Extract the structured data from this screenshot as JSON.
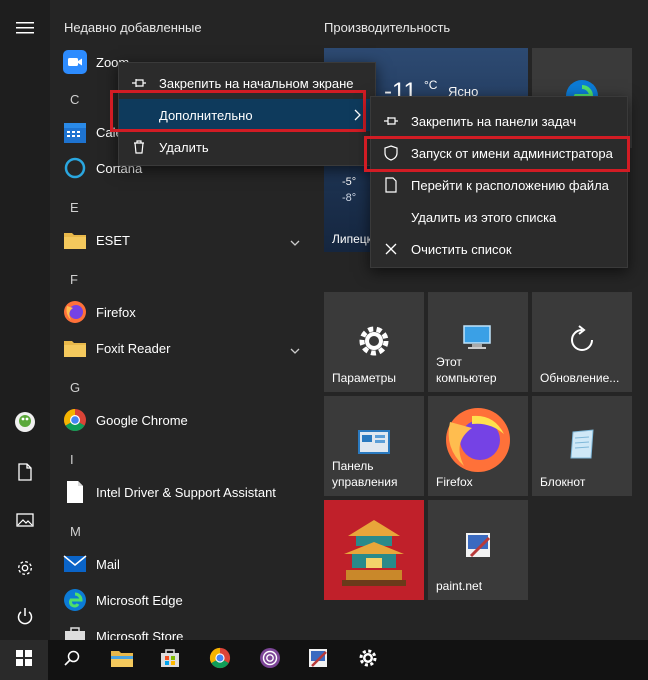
{
  "recent_header": "Недавно добавленные",
  "apps": {
    "zoom": "Zoom",
    "letter_c": "C",
    "calendar": "Calendar",
    "cortana": "Cortana",
    "letter_e": "E",
    "eset": "ESET",
    "letter_f": "F",
    "firefox": "Firefox",
    "foxit": "Foxit Reader",
    "letter_g": "G",
    "chrome": "Google Chrome",
    "letter_i": "I",
    "intel": "Intel Driver & Support Assistant",
    "letter_m": "M",
    "mail": "Mail",
    "edge": "Microsoft Edge",
    "store": "Microsoft Store"
  },
  "tiles_group": "Производительность",
  "weather": {
    "temp": "-11",
    "unit": "°C",
    "condition": "Ясно",
    "high": "-5°",
    "low": "-8°",
    "city": "Липецк"
  },
  "tiles": {
    "settings": "Параметры",
    "this_pc": "Этот компьютер",
    "update": "Обновление...",
    "control_panel": "Панель управления",
    "firefox": "Firefox",
    "notepad": "Блокнот",
    "paint": "paint.net"
  },
  "context_menu": {
    "pin_start": "Закрепить на начальном экране",
    "more": "Дополнительно",
    "uninstall": "Удалить"
  },
  "submenu": {
    "pin_taskbar": "Закрепить на панели задач",
    "run_admin": "Запуск от имени администратора",
    "open_location": "Перейти к расположению файла",
    "remove_list": "Удалить из этого списка",
    "clear_list": "Очистить список"
  },
  "colors": {
    "highlight": "#d21c24",
    "menu_hover": "#0e3a5c",
    "taskbar": "#121212"
  }
}
